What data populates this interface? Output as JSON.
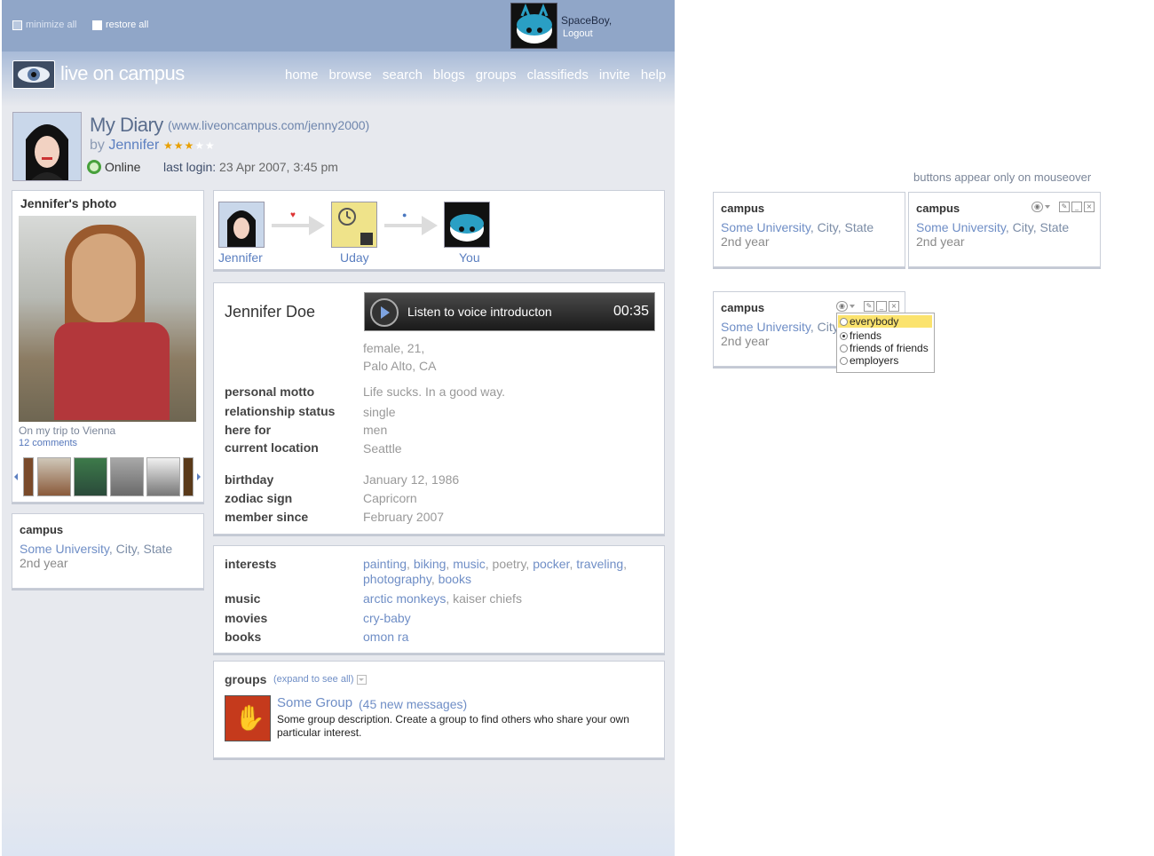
{
  "topbar": {
    "minimize_all": "minimize all",
    "restore_all": "restore all",
    "user_name": "SpaceBoy,",
    "logout": "Logout"
  },
  "brand": {
    "logo_text": "live on campus"
  },
  "nav": [
    "home",
    "browse",
    "search",
    "blogs",
    "groups",
    "classifieds",
    "invite",
    "help"
  ],
  "profile_header": {
    "title": "My Diary",
    "url": "(www.liveoncampus.com/jenny2000)",
    "by": "by",
    "name": "Jennifer",
    "stars_on": "★★★",
    "stars_off": "★★",
    "rating": 3,
    "rating_max": 5,
    "status": "Online",
    "last_login_label": "last login:",
    "last_login_value": "23 Apr 2007, 3:45 pm"
  },
  "photo_panel": {
    "title": "Jennifer's photo",
    "caption": "On my trip to Vienna",
    "comments": "12 comments"
  },
  "campus": {
    "title": "campus",
    "university": "Some University",
    "location": ", City, State",
    "location_cut": ", City",
    "year": "2nd year"
  },
  "connection": {
    "people": [
      "Jennifer",
      "Uday",
      "You"
    ],
    "links": [
      "♥",
      "●"
    ]
  },
  "profile": {
    "name": "Jennifer Doe",
    "voice_label": "Listen to voice introducton",
    "voice_time": "00:35",
    "gender_age": "female, 21,",
    "city": "Palo Alto, CA",
    "fields1": [
      {
        "label": "personal motto",
        "value": "Life sucks. In a good way."
      },
      {
        "label": "relationship status",
        "value": "single"
      },
      {
        "label": "here for",
        "value": "men"
      },
      {
        "label": "current location",
        "value": "Seattle"
      }
    ],
    "fields2": [
      {
        "label": "birthday",
        "value": "January 12, 1986"
      },
      {
        "label": "zodiac sign",
        "value": "Capricorn"
      },
      {
        "label": "member since",
        "value": "February 2007"
      }
    ]
  },
  "interests": {
    "interests_label": "interests",
    "i1": "painting",
    "i2": "biking",
    "i3": "music",
    "i4": "poetry",
    "i5": "pocker",
    "i6": "traveling",
    "i7": "photography",
    "i8": "books",
    "music_label": "music",
    "m1": "arctic monkeys",
    "m2": "kaiser chiefs",
    "movies_label": "movies",
    "mv1": "cry-baby",
    "books_label": "books",
    "b1": "omon ra"
  },
  "groups": {
    "title": "groups",
    "expand": "(expand to see all)",
    "name": "Some Group",
    "new_messages": "(45 new messages)",
    "description": "Some group description. Create a group to find others who share your own particular interest."
  },
  "side_note": "buttons appear only on mouseover",
  "privacy_options": [
    "everybody",
    "friends",
    "friends of friends",
    "employers"
  ],
  "colors": {
    "topbar": "#90a6c8",
    "link": "#6f8ec6",
    "highlight": "#fbe36e"
  }
}
